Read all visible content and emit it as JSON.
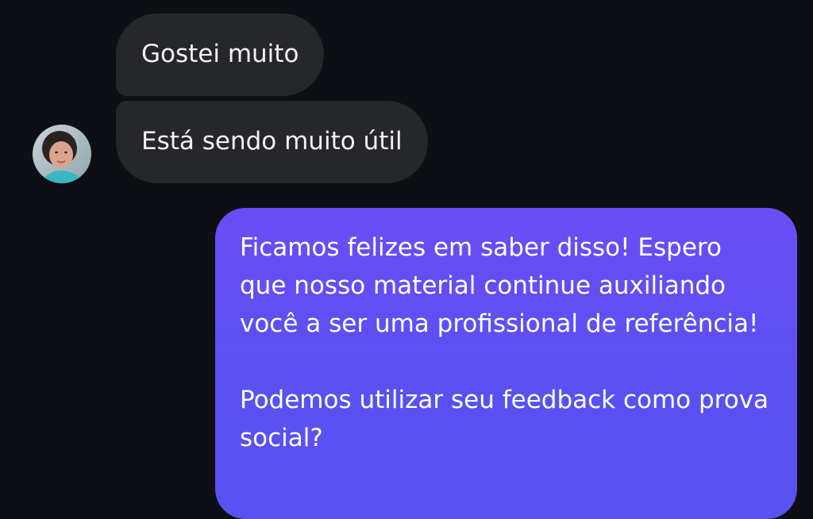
{
  "messages": {
    "incoming": [
      {
        "text": "Gostei muito"
      },
      {
        "text": "Está sendo muito útil"
      }
    ],
    "outgoing": {
      "paragraph1": "Ficamos felizes em saber disso! Espero que nosso material continue auxiliando você a ser uma profissional de referência!",
      "paragraph2": "Podemos utilizar seu feedback como prova social?"
    }
  },
  "colors": {
    "background": "#0d0f14",
    "incoming_bubble": "#26272b",
    "outgoing_bubble_top": "#6a4df4",
    "outgoing_bubble_bottom": "#5752f0"
  },
  "icons": {
    "avatar": "user-avatar-photo"
  }
}
